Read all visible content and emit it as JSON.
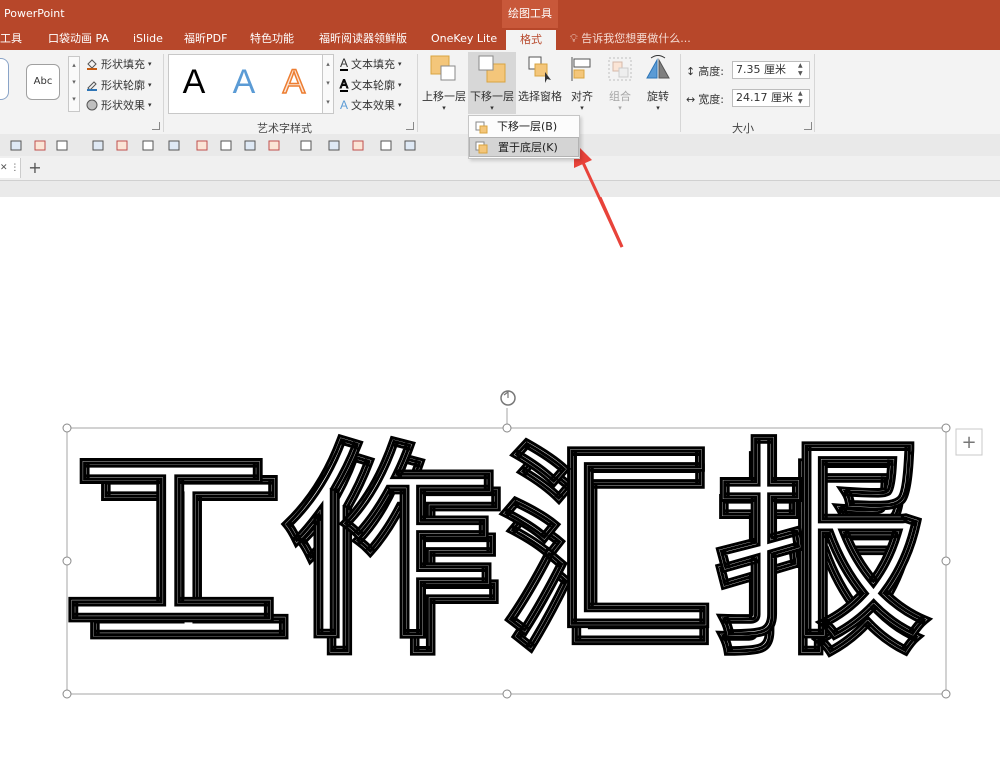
{
  "app": {
    "title": "PowerPoint",
    "context_header": "绘图工具"
  },
  "tabs": [
    "工具",
    "口袋动画 PA",
    "iSlide",
    "福昕PDF",
    "特色功能",
    "福昕阅读器领鲜版",
    "OneKey Lite",
    "格式"
  ],
  "active_tab": "格式",
  "tell_me": "告诉我您想要做什么...",
  "ribbon": {
    "shape_styles": {
      "sample": "Abc",
      "fill": "形状填充",
      "outline": "形状轮廓",
      "effects": "形状效果"
    },
    "wordart": {
      "samples": [
        "A",
        "A",
        "A"
      ],
      "text_fill": "文本填充",
      "text_outline": "文本轮廓",
      "text_effects": "文本效果",
      "group_label": "艺术字样式"
    },
    "arrange": {
      "bring_forward": "上移一层",
      "send_backward": "下移一层",
      "selection_pane": "选择窗格",
      "align": "对齐",
      "group": "组合",
      "rotate": "旋转"
    },
    "size": {
      "height_label": "高度:",
      "height_value": "7.35 厘米",
      "width_label": "宽度:",
      "width_value": "24.17 厘米",
      "group_label": "大小"
    }
  },
  "dropdown": {
    "items": [
      "下移一层(B)",
      "置于底层(K)"
    ],
    "highlighted": "置于底层(K)"
  },
  "tabstrip": {
    "add": "+"
  },
  "slide": {
    "text": "工作汇报",
    "side_button": "+"
  },
  "colors": {
    "brand": "#b7472a",
    "ribbon": "#f3f3f3",
    "arrow": "#e8433a",
    "wordart_blue": "#5b9bd5",
    "wordart_orange": "#f4b183"
  }
}
